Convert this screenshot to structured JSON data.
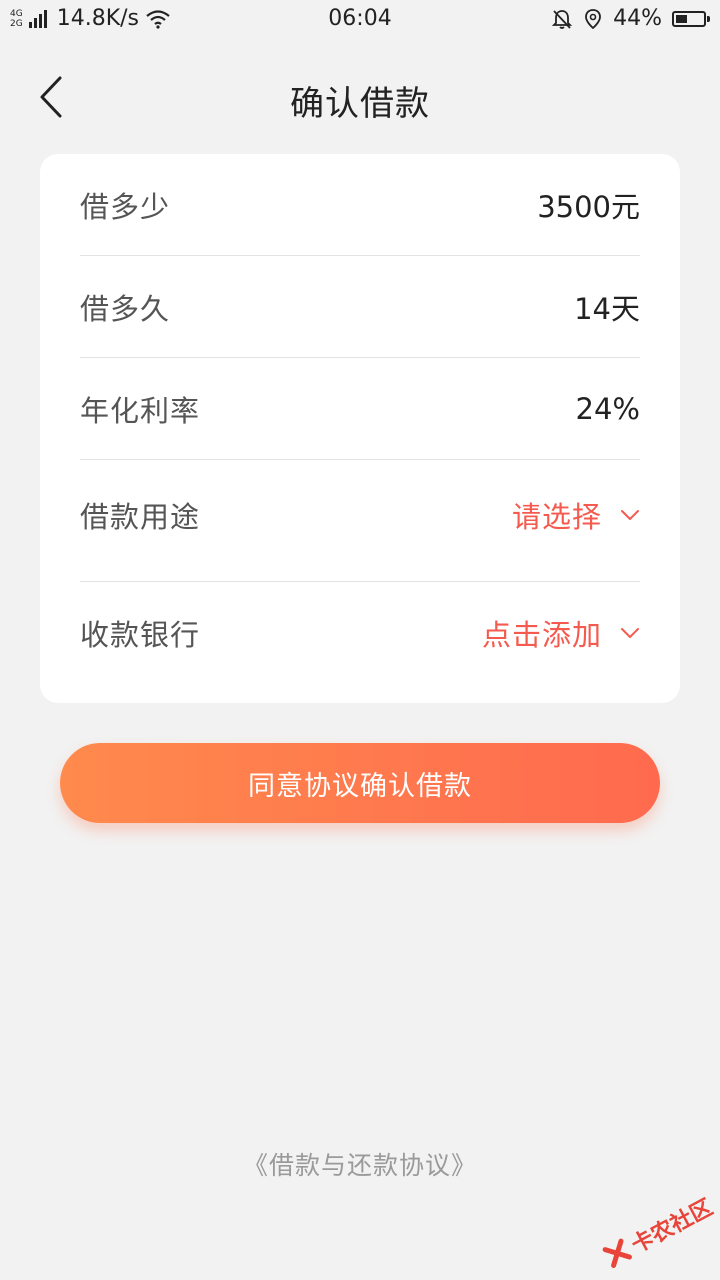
{
  "status_bar": {
    "network_top": "4G",
    "network_bottom": "2G",
    "speed": "14.8K/s",
    "time": "06:04",
    "battery_percent": "44%",
    "battery_level": 0.44,
    "icons": [
      "signal-icon",
      "wifi-icon",
      "mute-bell-icon",
      "location-icon",
      "battery-icon"
    ]
  },
  "header": {
    "title": "确认借款",
    "back_icon": "chevron-left-icon"
  },
  "loan_details": {
    "amount": {
      "label": "借多少",
      "value": "3500元"
    },
    "term": {
      "label": "借多久",
      "value": "14天"
    },
    "rate": {
      "label": "年化利率",
      "value": "24%"
    },
    "purpose": {
      "label": "借款用途",
      "placeholder": "请选择"
    },
    "bank": {
      "label": "收款银行",
      "placeholder": "点击添加"
    }
  },
  "actions": {
    "confirm_label": "同意协议确认借款"
  },
  "footer": {
    "agreement_link": "《借款与还款协议》"
  },
  "watermark": {
    "text": "卡农社区"
  },
  "colors": {
    "accent": "#f55a4e",
    "button_gradient_start": "#ff8a4d",
    "button_gradient_end": "#ff6a4e",
    "background": "#f2f2f2"
  }
}
